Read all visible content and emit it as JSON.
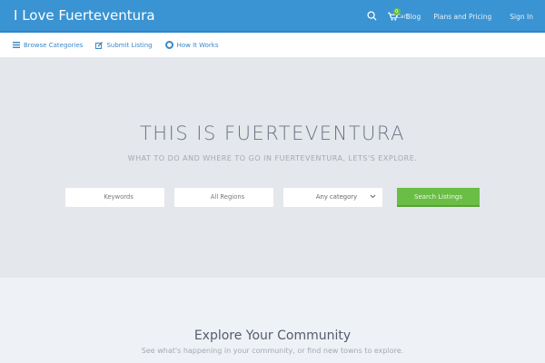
{
  "header": {
    "title": "I Love Fuerteventura",
    "cart_label": "Cart",
    "cart_count": "0",
    "nav": [
      "Blog",
      "Plans and Pricing",
      "Sign In"
    ]
  },
  "subnav": [
    {
      "label": "Browse Categories",
      "icon": "menu-icon"
    },
    {
      "label": "Submit Listing",
      "icon": "edit-icon"
    },
    {
      "label": "How It Works",
      "icon": "lifebuoy-icon"
    }
  ],
  "hero": {
    "title": "THIS IS FUERTEVENTURA",
    "subtitle": "WHAT TO DO AND WHERE TO GO IN FUERTEVENTURA, LETS'S EXPLORE.",
    "keywords_placeholder": "Keywords",
    "regions_placeholder": "All Regions",
    "category_value": "Any category",
    "search_button": "Search Listings"
  },
  "section": {
    "title": "Explore Your Community",
    "subtitle": "See what's happening in your community, or find new towns to explore."
  }
}
